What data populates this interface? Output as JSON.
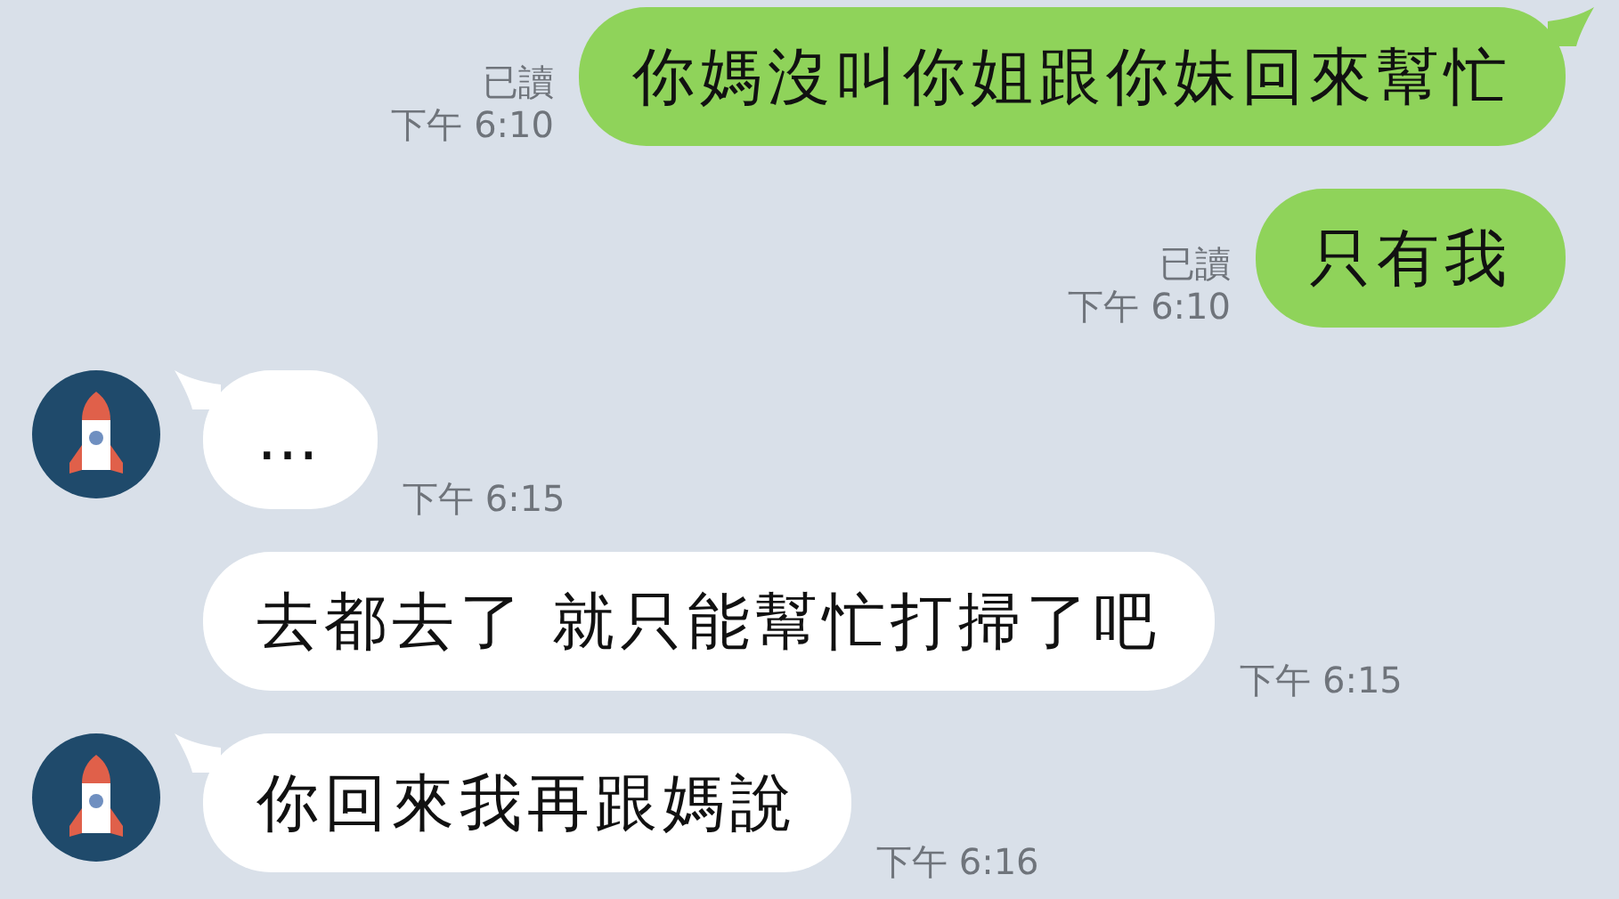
{
  "messages": [
    {
      "kind": "outgoing",
      "text": "你媽沒叫你姐跟你妹回來幫忙",
      "read_label": "已讀",
      "time": "下午 6:10",
      "tail": true
    },
    {
      "kind": "outgoing",
      "text": "只有我",
      "read_label": "已讀",
      "time": "下午 6:10",
      "tail": false
    },
    {
      "kind": "incoming",
      "text": "…",
      "time": "下午 6:15",
      "tail": true
    },
    {
      "kind": "incoming",
      "text": "去都去了 就只能幫忙打掃了吧",
      "time": "下午 6:15",
      "tail": false
    },
    {
      "kind": "incoming",
      "text": "你回來我再跟媽說",
      "time": "下午 6:16",
      "tail": true
    }
  ]
}
